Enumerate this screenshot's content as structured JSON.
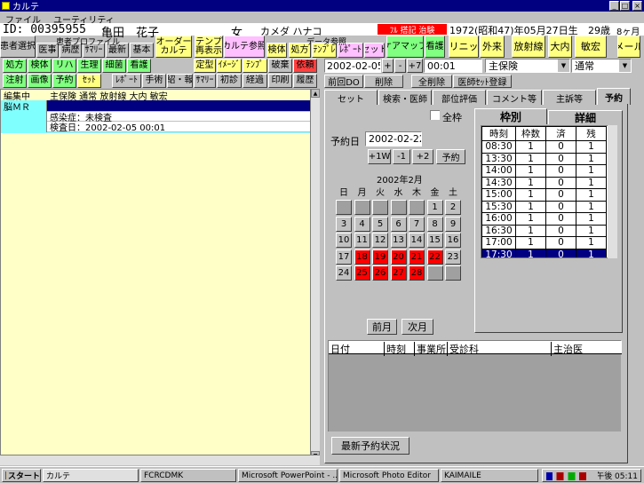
{
  "window": {
    "title": "カルテ",
    "menu": [
      "ファイル",
      "ユーティリティ"
    ]
  },
  "patient": {
    "id": "ID: 00395955",
    "name": "亀田　花子",
    "sex": "女",
    "kana": "カメダ ハナコ",
    "flag": "ﾌﾙ 搭記 治験",
    "birth": "1972(昭和47)年05月27日生",
    "age": "29歳",
    "months": "8ヶ月"
  },
  "left_buttons": {
    "row1": [
      {
        "label": "患者選択",
        "color": "#c0c0c0"
      },
      {
        "label": "医事",
        "color": "#c0c0c0"
      },
      {
        "label": "病歴",
        "color": "#c0c0c0"
      },
      {
        "label": "ｻﾏﾘｰ",
        "color": "#c0c0c0"
      },
      {
        "label": "最新",
        "color": "#c0c0c0"
      },
      {
        "label": "基本",
        "color": "#c0c0c0"
      },
      {
        "label": "オーダー\nカルテ",
        "color": "#ffff80"
      },
      {
        "label": "テンプ\n再表示",
        "color": "#ffff80"
      },
      {
        "label": "カルテ参照",
        "color": "#ffc0ff"
      },
      {
        "label": "検体",
        "color": "#ffff80"
      },
      {
        "label": "処方",
        "color": "#ffff80"
      },
      {
        "label": "ﾃﾝﾌﾟﾚ",
        "color": "#ffff80"
      },
      {
        "label": "ﾚﾎﾟｰﾄ",
        "color": "#ffc0ff"
      },
      {
        "label": "セット",
        "color": "#ffc0ff"
      },
      {
        "label": "ケアマップ",
        "color": "#80ff80"
      },
      {
        "label": "看護",
        "color": "#80ff80"
      },
      {
        "label": "クリニック",
        "color": "#ffff80"
      },
      {
        "label": "外来",
        "color": "#ffff80"
      },
      {
        "label": "放射線",
        "color": "#ffff80"
      },
      {
        "label": "大内",
        "color": "#ffff80"
      },
      {
        "label": "敏宏",
        "color": "#ffff80"
      },
      {
        "label": "メール",
        "color": "#ffff80"
      }
    ],
    "profile_label": "患者プロファイル",
    "data_label": "データ参照",
    "row2": [
      {
        "label": "処方",
        "color": "#80ff80"
      },
      {
        "label": "検体",
        "color": "#80ff80"
      },
      {
        "label": "リハ",
        "color": "#80ff80"
      },
      {
        "label": "生理",
        "color": "#80ff80"
      },
      {
        "label": "細菌",
        "color": "#80ff80"
      },
      {
        "label": "看護",
        "color": "#80ff80"
      },
      {
        "label": "定型",
        "color": "#ffff80"
      },
      {
        "label": "ｲﾒｰｼﾞ",
        "color": "#ffff80"
      },
      {
        "label": "ﾃﾝﾌﾟ",
        "color": "#ffff80"
      },
      {
        "label": "破棄",
        "color": "#c0c0c0"
      },
      {
        "label": "依頼",
        "color": "#ff4040"
      }
    ],
    "row3": [
      {
        "label": "注射",
        "color": "#80ff80"
      },
      {
        "label": "画像",
        "color": "#80ff80"
      },
      {
        "label": "予約",
        "color": "#80ff80"
      },
      {
        "label": "ｾｯﾄ",
        "color": "#ffff80"
      },
      {
        "label": "ﾚﾎﾟｰﾄ",
        "color": "#c0c0c0"
      },
      {
        "label": "手術",
        "color": "#c0c0c0"
      },
      {
        "label": "紹・報",
        "color": "#c0c0c0"
      },
      {
        "label": "ｻﾏﾘｰ",
        "color": "#c0c0c0"
      },
      {
        "label": "初診",
        "color": "#c0c0c0"
      },
      {
        "label": "経過",
        "color": "#c0c0c0"
      },
      {
        "label": "印刷",
        "color": "#c0c0c0"
      },
      {
        "label": "履歴",
        "color": "#c0c0c0"
      }
    ]
  },
  "karte": {
    "rows": [
      {
        "left": "編集中",
        "right": "主保険 通常 放射線 大内 敏宏"
      },
      {
        "left": "脳ＭＲ",
        "right": ""
      },
      {
        "left": "",
        "right": "感染症：未検査"
      },
      {
        "left": "",
        "right": "検査日：2002-02-05 00:01"
      }
    ]
  },
  "order": {
    "date": "2002-02-05",
    "time": "00:01",
    "insurance": "主保険",
    "type": "通常",
    "plus": "+",
    "minus": "-",
    "plus7": "+7",
    "buttons": [
      "前回DO",
      "削除",
      "全削除",
      "医師ｾｯﾄ登録"
    ]
  },
  "tabs": [
    "セット",
    "検索・医師",
    "部位評価",
    "コメント等",
    "主訴等",
    "予約"
  ],
  "reserve": {
    "all_label": "全枠",
    "date_label": "予約日",
    "date": "2002-02-22",
    "nav": [
      "+1W",
      "-1",
      "+2",
      "予約"
    ],
    "month": "2002年2月",
    "weekdays": [
      "日",
      "月",
      "火",
      "水",
      "木",
      "金",
      "土"
    ],
    "days": [
      [
        "",
        "",
        "",
        "",
        "",
        "1",
        "2"
      ],
      [
        "3",
        "4",
        "5",
        "6",
        "7",
        "8",
        "9"
      ],
      [
        "10",
        "11",
        "12",
        "13",
        "14",
        "15",
        "16"
      ],
      [
        "17",
        "18",
        "19",
        "20",
        "21",
        "22",
        "23"
      ],
      [
        "24",
        "25",
        "26",
        "27",
        "28",
        "",
        ""
      ]
    ],
    "red_days": [
      "18",
      "19",
      "20",
      "21",
      "22",
      "25",
      "26",
      "27",
      "28"
    ],
    "prev": "前月",
    "next": "次月",
    "subtabs": [
      "枠別",
      "詳細"
    ],
    "grid_headers": [
      "時刻",
      "枠数",
      "済",
      "残"
    ],
    "grid_rows": [
      [
        "08:30",
        "1",
        "0",
        "1"
      ],
      [
        "13:30",
        "1",
        "0",
        "1"
      ],
      [
        "14:00",
        "1",
        "0",
        "1"
      ],
      [
        "14:30",
        "1",
        "0",
        "1"
      ],
      [
        "15:00",
        "1",
        "0",
        "1"
      ],
      [
        "15:30",
        "1",
        "0",
        "1"
      ],
      [
        "16:00",
        "1",
        "0",
        "1"
      ],
      [
        "16:30",
        "1",
        "0",
        "1"
      ],
      [
        "17:00",
        "1",
        "0",
        "1"
      ],
      [
        "17:30",
        "1",
        "0",
        "1"
      ]
    ],
    "selected_row": 9,
    "list_headers": [
      "日付",
      "時刻",
      "事業所",
      "受診科",
      "主治医"
    ],
    "latest_button": "最新予約状況"
  },
  "taskbar": {
    "start": "スタート",
    "tasks": [
      "カルテ",
      "FCRCDMK",
      "Microsoft PowerPoint - ...",
      "Microsoft Photo Editor",
      "KAIMAILE"
    ],
    "clock": "午後 05:11"
  }
}
